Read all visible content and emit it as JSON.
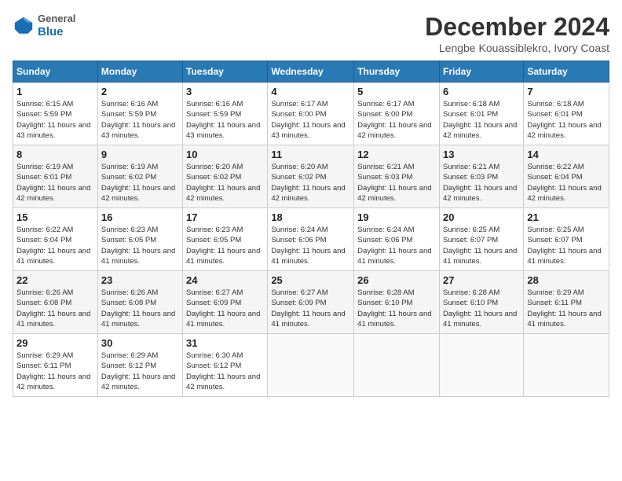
{
  "header": {
    "logo_general": "General",
    "logo_blue": "Blue",
    "month_title": "December 2024",
    "location": "Lengbe Kouassiblekro, Ivory Coast"
  },
  "weekdays": [
    "Sunday",
    "Monday",
    "Tuesday",
    "Wednesday",
    "Thursday",
    "Friday",
    "Saturday"
  ],
  "weeks": [
    [
      {
        "day": "1",
        "sunrise": "6:15 AM",
        "sunset": "5:59 PM",
        "daylight": "11 hours and 43 minutes."
      },
      {
        "day": "2",
        "sunrise": "6:16 AM",
        "sunset": "5:59 PM",
        "daylight": "11 hours and 43 minutes."
      },
      {
        "day": "3",
        "sunrise": "6:16 AM",
        "sunset": "5:59 PM",
        "daylight": "11 hours and 43 minutes."
      },
      {
        "day": "4",
        "sunrise": "6:17 AM",
        "sunset": "6:00 PM",
        "daylight": "11 hours and 43 minutes."
      },
      {
        "day": "5",
        "sunrise": "6:17 AM",
        "sunset": "6:00 PM",
        "daylight": "11 hours and 42 minutes."
      },
      {
        "day": "6",
        "sunrise": "6:18 AM",
        "sunset": "6:01 PM",
        "daylight": "11 hours and 42 minutes."
      },
      {
        "day": "7",
        "sunrise": "6:18 AM",
        "sunset": "6:01 PM",
        "daylight": "11 hours and 42 minutes."
      }
    ],
    [
      {
        "day": "8",
        "sunrise": "6:19 AM",
        "sunset": "6:01 PM",
        "daylight": "11 hours and 42 minutes."
      },
      {
        "day": "9",
        "sunrise": "6:19 AM",
        "sunset": "6:02 PM",
        "daylight": "11 hours and 42 minutes."
      },
      {
        "day": "10",
        "sunrise": "6:20 AM",
        "sunset": "6:02 PM",
        "daylight": "11 hours and 42 minutes."
      },
      {
        "day": "11",
        "sunrise": "6:20 AM",
        "sunset": "6:02 PM",
        "daylight": "11 hours and 42 minutes."
      },
      {
        "day": "12",
        "sunrise": "6:21 AM",
        "sunset": "6:03 PM",
        "daylight": "11 hours and 42 minutes."
      },
      {
        "day": "13",
        "sunrise": "6:21 AM",
        "sunset": "6:03 PM",
        "daylight": "11 hours and 42 minutes."
      },
      {
        "day": "14",
        "sunrise": "6:22 AM",
        "sunset": "6:04 PM",
        "daylight": "11 hours and 42 minutes."
      }
    ],
    [
      {
        "day": "15",
        "sunrise": "6:22 AM",
        "sunset": "6:04 PM",
        "daylight": "11 hours and 41 minutes."
      },
      {
        "day": "16",
        "sunrise": "6:23 AM",
        "sunset": "6:05 PM",
        "daylight": "11 hours and 41 minutes."
      },
      {
        "day": "17",
        "sunrise": "6:23 AM",
        "sunset": "6:05 PM",
        "daylight": "11 hours and 41 minutes."
      },
      {
        "day": "18",
        "sunrise": "6:24 AM",
        "sunset": "6:06 PM",
        "daylight": "11 hours and 41 minutes."
      },
      {
        "day": "19",
        "sunrise": "6:24 AM",
        "sunset": "6:06 PM",
        "daylight": "11 hours and 41 minutes."
      },
      {
        "day": "20",
        "sunrise": "6:25 AM",
        "sunset": "6:07 PM",
        "daylight": "11 hours and 41 minutes."
      },
      {
        "day": "21",
        "sunrise": "6:25 AM",
        "sunset": "6:07 PM",
        "daylight": "11 hours and 41 minutes."
      }
    ],
    [
      {
        "day": "22",
        "sunrise": "6:26 AM",
        "sunset": "6:08 PM",
        "daylight": "11 hours and 41 minutes."
      },
      {
        "day": "23",
        "sunrise": "6:26 AM",
        "sunset": "6:08 PM",
        "daylight": "11 hours and 41 minutes."
      },
      {
        "day": "24",
        "sunrise": "6:27 AM",
        "sunset": "6:09 PM",
        "daylight": "11 hours and 41 minutes."
      },
      {
        "day": "25",
        "sunrise": "6:27 AM",
        "sunset": "6:09 PM",
        "daylight": "11 hours and 41 minutes."
      },
      {
        "day": "26",
        "sunrise": "6:28 AM",
        "sunset": "6:10 PM",
        "daylight": "11 hours and 41 minutes."
      },
      {
        "day": "27",
        "sunrise": "6:28 AM",
        "sunset": "6:10 PM",
        "daylight": "11 hours and 41 minutes."
      },
      {
        "day": "28",
        "sunrise": "6:29 AM",
        "sunset": "6:11 PM",
        "daylight": "11 hours and 41 minutes."
      }
    ],
    [
      {
        "day": "29",
        "sunrise": "6:29 AM",
        "sunset": "6:11 PM",
        "daylight": "11 hours and 42 minutes."
      },
      {
        "day": "30",
        "sunrise": "6:29 AM",
        "sunset": "6:12 PM",
        "daylight": "11 hours and 42 minutes."
      },
      {
        "day": "31",
        "sunrise": "6:30 AM",
        "sunset": "6:12 PM",
        "daylight": "11 hours and 42 minutes."
      },
      null,
      null,
      null,
      null
    ]
  ]
}
